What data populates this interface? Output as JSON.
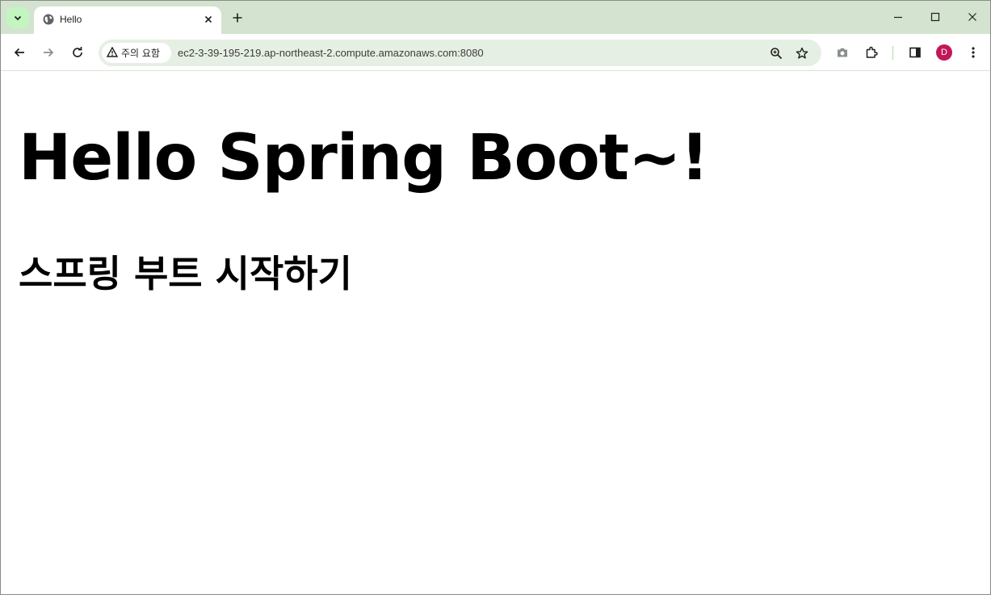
{
  "browser": {
    "tab": {
      "title": "Hello"
    },
    "address_bar": {
      "security_chip": "주의 요함",
      "url": "ec2-3-39-195-219.ap-northeast-2.compute.amazonaws.com:8080"
    },
    "profile_initial": "D",
    "icons": {
      "tab_search": "chevron-down-icon",
      "tab_favicon": "globe-icon",
      "tab_close": "close-icon",
      "new_tab": "plus-icon",
      "minimize": "minimize-icon",
      "maximize": "maximize-icon",
      "close_window": "close-icon",
      "back": "arrow-left-icon",
      "forward": "arrow-right-icon",
      "reload": "reload-icon",
      "warning": "warning-icon",
      "zoom": "zoom-icon",
      "bookmark": "star-icon",
      "screenshot": "camera-icon",
      "extensions": "puzzle-icon",
      "side_panel": "side-panel-icon",
      "menu": "more-vert-icon"
    },
    "colors": {
      "frame": "#d3e3cf",
      "avatar": "#c2185b"
    }
  },
  "page": {
    "heading": "Hello Spring Boot~!",
    "subheading": "스프링 부트 시작하기"
  }
}
